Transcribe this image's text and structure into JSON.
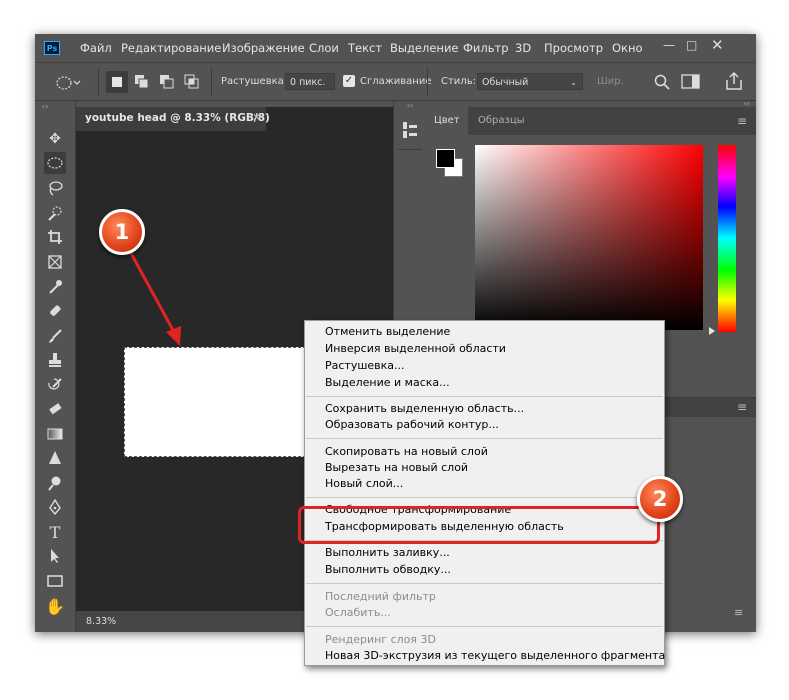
{
  "menubar": {
    "logo": "Ps",
    "items": [
      "Файл",
      "Редактирование",
      "Изображение",
      "Слои",
      "Текст",
      "Выделение",
      "Фильтр",
      "3D",
      "Просмотр",
      "Окно"
    ]
  },
  "options_bar": {
    "feather_label": "Растушевка:",
    "feather_value": "0 пикс.",
    "antialias_label": "Сглаживание",
    "style_label": "Стиль:",
    "style_value": "Обычный",
    "width_label": "Шир."
  },
  "document": {
    "tab_title": "youtube head @ 8.33% (RGB/8)",
    "zoom": "8.33%"
  },
  "panel": {
    "tab_color": "Цвет",
    "tab_swatches": "Образцы"
  },
  "context_menu": {
    "items": [
      {
        "label": "Отменить выделение",
        "enabled": true
      },
      {
        "label": "Инверсия выделенной области",
        "enabled": true
      },
      {
        "label": "Растушевка...",
        "enabled": true
      },
      {
        "label": "Выделение и маска...",
        "enabled": true
      },
      {
        "label": "Сохранить выделенную область...",
        "enabled": true
      },
      {
        "label": "Образовать рабочий контур...",
        "enabled": true
      },
      {
        "label": "Скопировать на новый слой",
        "enabled": true
      },
      {
        "label": "Вырезать на новый слой",
        "enabled": true
      },
      {
        "label": "Новый слой...",
        "enabled": true
      },
      {
        "label": "Свободное трансформирование",
        "enabled": true
      },
      {
        "label": "Трансформировать выделенную область",
        "enabled": true
      },
      {
        "label": "Выполнить заливку...",
        "enabled": true
      },
      {
        "label": "Выполнить обводку...",
        "enabled": true
      },
      {
        "label": "Последний фильтр",
        "enabled": false
      },
      {
        "label": "Ослабить...",
        "enabled": false
      },
      {
        "label": "Рендеринг слоя 3D",
        "enabled": false
      },
      {
        "label": "Новая 3D-экструзия из текущего выделенного фрагмента",
        "enabled": true
      }
    ]
  },
  "annotations": {
    "badge1": "1",
    "badge2": "2"
  },
  "colors": {
    "accent": "#e02424",
    "ui_bg": "#535353",
    "canvas_bg": "#282828"
  }
}
